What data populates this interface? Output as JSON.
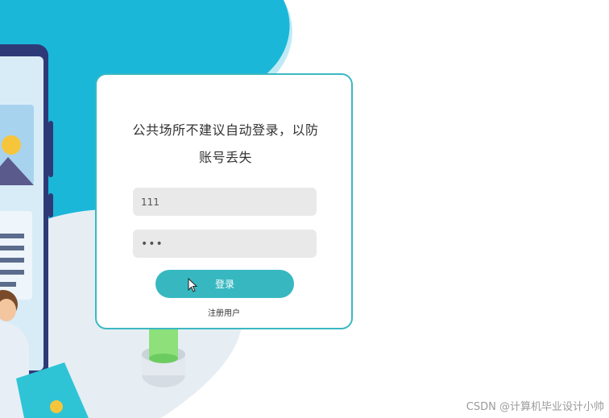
{
  "login": {
    "notice": "公共场所不建议自动登录，以防账号丢失",
    "username_value": "111",
    "password_value": "•••",
    "submit_label": "登录",
    "register_label": "注册用户"
  },
  "watermark": "CSDN @计算机毕业设计小帅",
  "colors": {
    "accent": "#37b8c1",
    "card_border": "#3bb8c2",
    "illustration_teal": "#1bb7d9",
    "field_bg": "#e9e9e9"
  },
  "icons": {
    "cursor": "mouse-pointer-icon"
  }
}
